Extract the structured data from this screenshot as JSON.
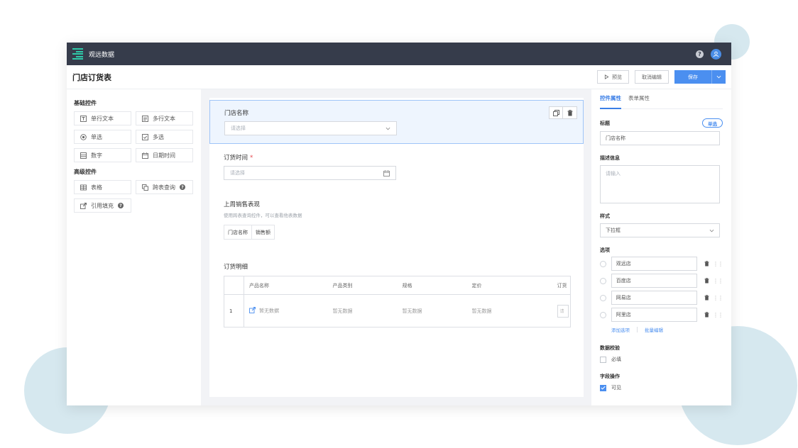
{
  "topbar": {
    "app_name": "观远数据"
  },
  "titlebar": {
    "page_title": "门店订货表",
    "preview_label": "预览",
    "cancel_edit_label": "取消编辑",
    "save_label": "保存"
  },
  "left": {
    "basic_title": "基础控件",
    "advanced_title": "高级控件",
    "basic_items": [
      "单行文本",
      "多行文本",
      "单选",
      "多选",
      "数字",
      "日期时间"
    ],
    "advanced_items": [
      "表格",
      "跨表查询",
      "引用填充"
    ]
  },
  "form": {
    "store": {
      "label": "门店名称",
      "placeholder": "请选择"
    },
    "order_time": {
      "label": "订货时间",
      "required_mark": "*",
      "placeholder": "请选择"
    },
    "sales": {
      "label": "上周销售表现",
      "hint": "使用跨表查询控件，可以查看他表数据",
      "columns": [
        "门店名称",
        "销售额"
      ]
    },
    "detail": {
      "label": "订货明细",
      "headers": [
        "产品名称",
        "产品类别",
        "规格",
        "定价",
        "订货"
      ],
      "row_index": "1",
      "empty_text": "暂无数据",
      "mini_placeholder": "请"
    }
  },
  "props": {
    "tab_control": "控件属性",
    "tab_form": "表单属性",
    "title_label": "标题",
    "title_mode": "单选",
    "title_value": "门店名称",
    "desc_label": "描述信息",
    "desc_placeholder": "请输入",
    "style_label": "样式",
    "style_value": "下拉框",
    "options_label": "选项",
    "options": [
      "观远店",
      "百度店",
      "网易店",
      "阿里店"
    ],
    "add_option": "添加选项",
    "batch_edit": "批量编辑",
    "validate_label": "数据校验",
    "required_label": "必填",
    "field_ops_label": "字段操作",
    "visible_label": "可见"
  },
  "colors": {
    "accent": "#4b8ff0",
    "topbar": "#363c4b",
    "logo": "#2fc9a8",
    "deco": "#d6e8ef"
  }
}
